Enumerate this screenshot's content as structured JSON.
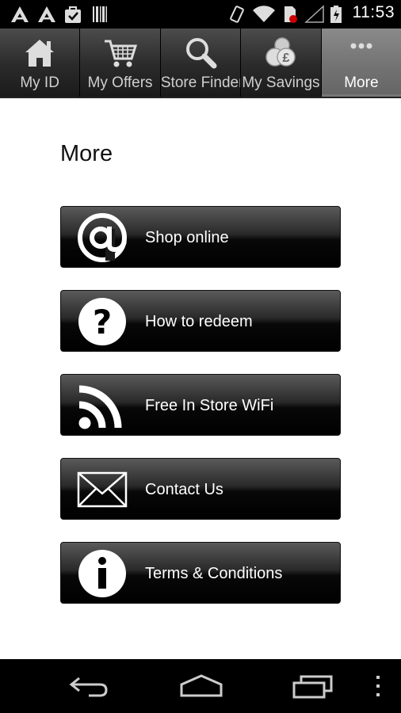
{
  "status_bar": {
    "time": "11:53",
    "icons": [
      "notification-a-icon",
      "notification-a-icon",
      "bag-icon",
      "barcode-icon",
      "vibrate-icon",
      "wifi-icon",
      "sim-alert-icon",
      "signal-icon",
      "battery-icon"
    ]
  },
  "tabs": [
    {
      "label": "My ID",
      "icon": "home-icon",
      "active": false
    },
    {
      "label": "My Offers",
      "icon": "cart-icon",
      "active": false
    },
    {
      "label": "Store Finder",
      "icon": "magnifier-icon",
      "active": false
    },
    {
      "label": "My Savings",
      "icon": "coins-icon",
      "active": false
    },
    {
      "label": "More",
      "icon": "more-dots-icon",
      "active": true
    }
  ],
  "page": {
    "title": "More"
  },
  "menu": [
    {
      "label": "Shop online",
      "icon": "at-icon"
    },
    {
      "label": "How to redeem",
      "icon": "question-icon"
    },
    {
      "label": "Free In Store WiFi",
      "icon": "rss-wifi-icon"
    },
    {
      "label": "Contact Us",
      "icon": "envelope-icon"
    },
    {
      "label": "Terms & Conditions",
      "icon": "info-icon"
    }
  ],
  "nav_bar": {
    "buttons": [
      "back-icon",
      "home-nav-icon",
      "recent-apps-icon",
      "overflow-menu-icon"
    ]
  },
  "colors": {
    "tab_bg": "#2b2b2b",
    "tab_active_bg": "#727272",
    "button_bg": "#000000",
    "text_dark": "#111111"
  }
}
